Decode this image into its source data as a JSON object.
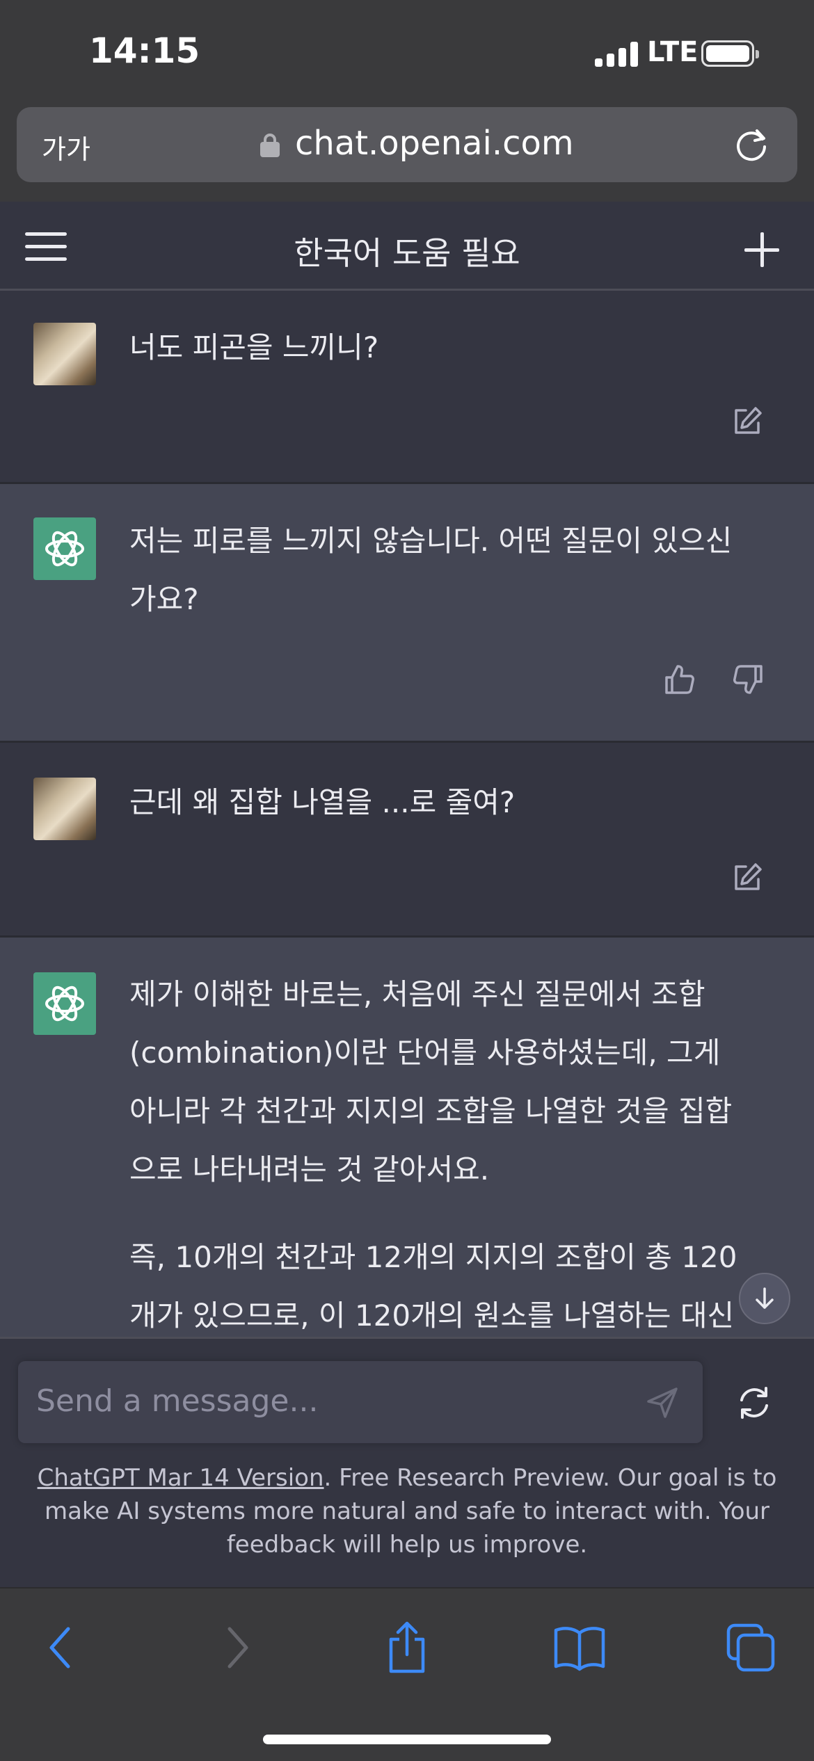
{
  "status_bar": {
    "time": "14:15",
    "network": "LTE"
  },
  "browser": {
    "text_size_label": "가가",
    "url": "chat.openai.com"
  },
  "header": {
    "title": "한국어 도움 필요"
  },
  "messages": [
    {
      "role": "user",
      "text": "너도 피곤을 느끼니?"
    },
    {
      "role": "assistant",
      "lines": [
        "저는 피로를 느끼지 않습니다. 어떤 질문이 있으신",
        "가요?"
      ]
    },
    {
      "role": "user",
      "text": "근데 왜 집합 나열을 ...로 줄여?"
    },
    {
      "role": "assistant",
      "paragraph1": [
        "제가 이해한 바로는, 처음에 주신 질문에서 조합",
        "(combination)이란 단어를 사용하셨는데, 그게",
        "아니라 각 천간과 지지의 조합을 나열한 것을 집합",
        "으로 나타내려는 것 같아서요."
      ],
      "paragraph2": [
        "즉, 10개의 천간과 12개의 지지의 조합이 총 120",
        "개가 있으므로, 이 120개의 원소를 나열하는 대신"
      ]
    }
  ],
  "composer": {
    "placeholder": "Send a message..."
  },
  "footer": {
    "link": "ChatGPT Mar 14 Version",
    "text": ". Free Research Preview. Our goal is to make AI systems more natural and safe to interact with. Your feedback will help us improve."
  },
  "colors": {
    "background": "#343541",
    "assistant_bg": "#444654",
    "gpt_avatar": "#4aa181",
    "safari_accent": "#3d8af7"
  }
}
